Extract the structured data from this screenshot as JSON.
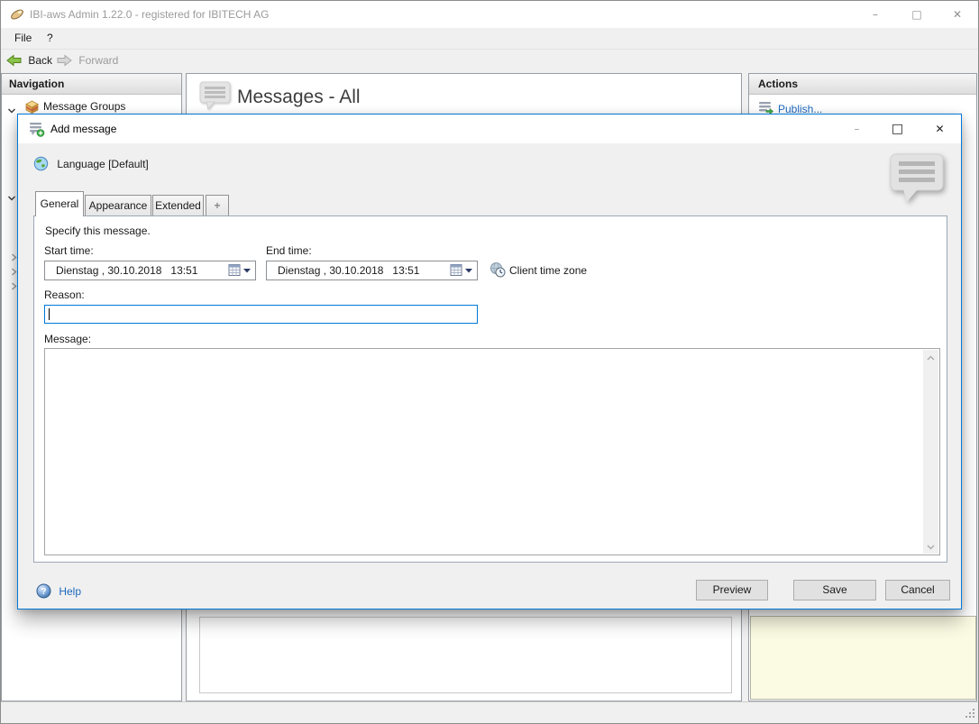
{
  "window": {
    "title": "IBI-aws Admin 1.22.0 - registered for IBITECH AG"
  },
  "icons": {
    "minimize_glyph": "–",
    "maximize_glyph": "□",
    "close_glyph": "✕"
  },
  "menu": {
    "file_label": "File",
    "help_label": "?"
  },
  "toolbar": {
    "back_label": "Back",
    "forward_label": "Forward"
  },
  "navigation": {
    "header": "Navigation",
    "items": [
      {
        "label": "Message Groups"
      }
    ]
  },
  "main": {
    "title": "Messages - All"
  },
  "actions": {
    "header": "Actions",
    "publish_label": "Publish..."
  },
  "dialog": {
    "title": "Add message",
    "language_label": "Language [Default]",
    "tabs": [
      {
        "label": "General",
        "active": true
      },
      {
        "label": "Appearance",
        "active": false
      },
      {
        "label": "Extended",
        "active": false
      },
      {
        "label": "+",
        "active": false
      }
    ],
    "group_text": "Specify this message.",
    "start_time_label": "Start time:",
    "end_time_label": "End time:",
    "start_time_value": "Dienstag , 30.10.2018   13:51",
    "end_time_value": "Dienstag , 30.10.2018   13:51",
    "client_time_zone_label": "Client time zone",
    "reason_label": "Reason:",
    "reason_value": "",
    "message_label": "Message:",
    "message_value": "",
    "help_label": "Help",
    "buttons": {
      "preview": "Preview",
      "save": "Save",
      "cancel": "Cancel"
    }
  },
  "colors": {
    "accent_blue": "#0078d7",
    "link_blue": "#1d68bd",
    "note_yellow": "#fbfbe3",
    "back_arrow_green": "#8bc34a"
  }
}
